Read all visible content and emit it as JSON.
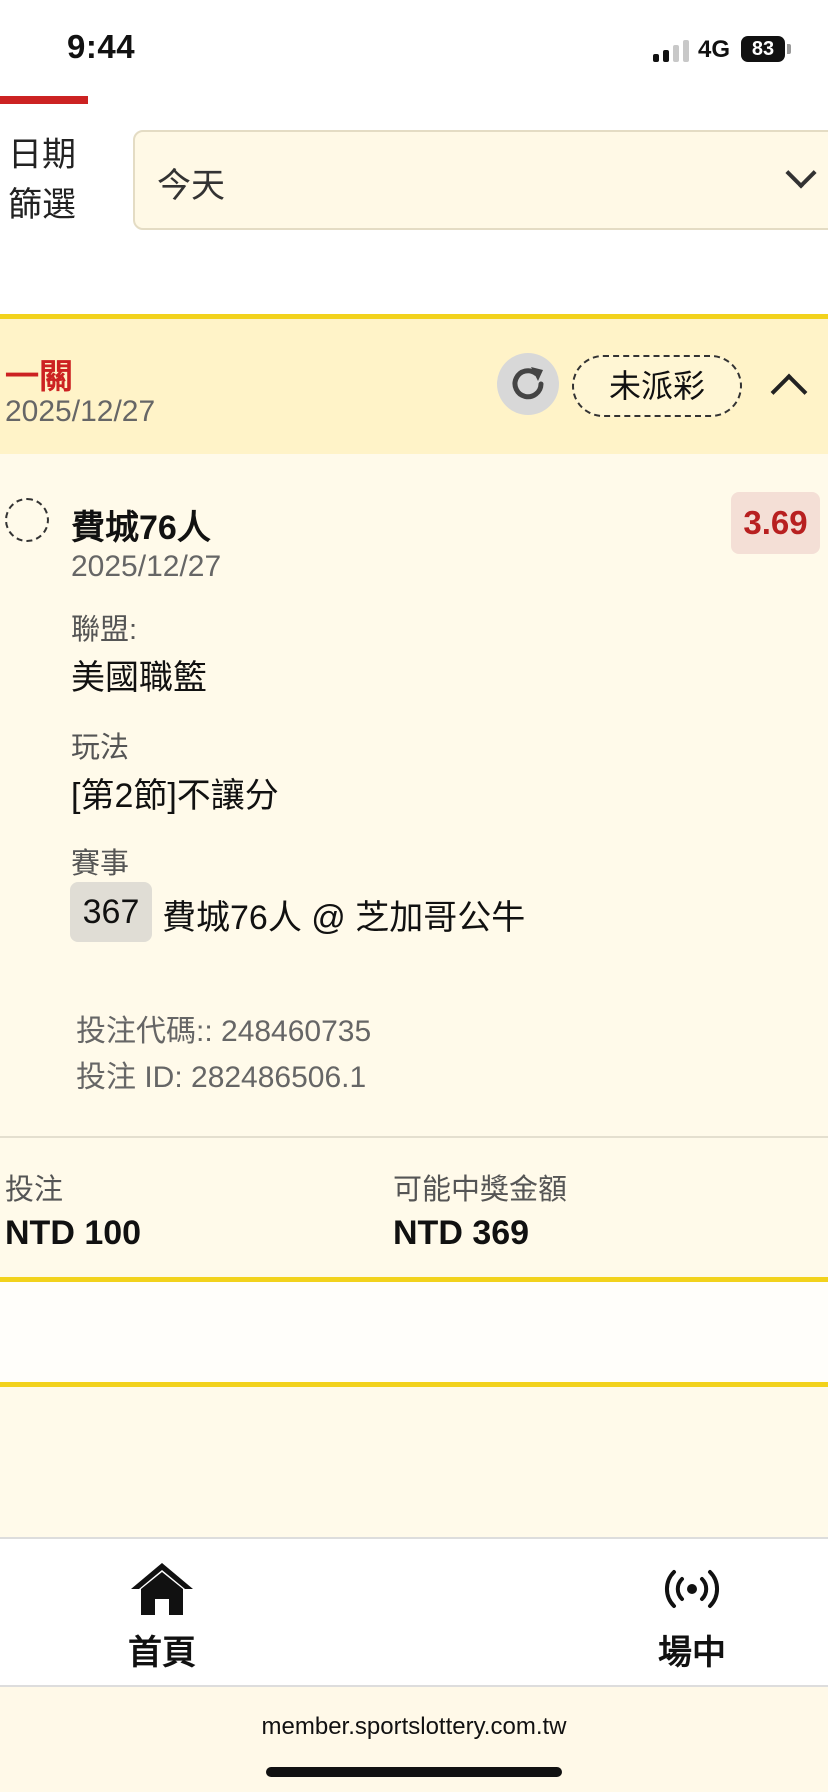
{
  "status_bar": {
    "time": "9:44",
    "network": "4G",
    "battery": "83"
  },
  "filter": {
    "label_line1": "日期",
    "label_line2": "篩選",
    "value": "今天"
  },
  "bet": {
    "type": "一關",
    "date": "2025/12/27",
    "status": "未派彩",
    "selection": {
      "team": "費城76人",
      "date": "2025/12/27",
      "odds": "3.69",
      "league_label": "聯盟:",
      "league": "美國職籃",
      "play_label": "玩法",
      "play": "[第2節]不讓分",
      "game_label": "賽事",
      "game_code": "367",
      "game": "費城76人 @ 芝加哥公牛"
    },
    "bet_code": "投注代碼:: 248460735",
    "bet_id": "投注 ID: 282486506.1",
    "stake_label": "投注",
    "stake": "NTD 100",
    "payout_label": "可能中獎金額",
    "payout": "NTD 369"
  },
  "nav": {
    "home": "首頁",
    "live": "場中"
  },
  "browser": {
    "url": "member.sportslottery.com.tw"
  },
  "icons": [
    "refresh-icon",
    "chevron-down-icon",
    "chevron-up-icon",
    "home-icon",
    "live-broadcast-icon"
  ],
  "colors": {
    "accent_red": "#cc2222",
    "accent_yellow": "#f2d21c",
    "header_bg": "#fff3c8",
    "odds_bg": "#f4dfd6"
  }
}
